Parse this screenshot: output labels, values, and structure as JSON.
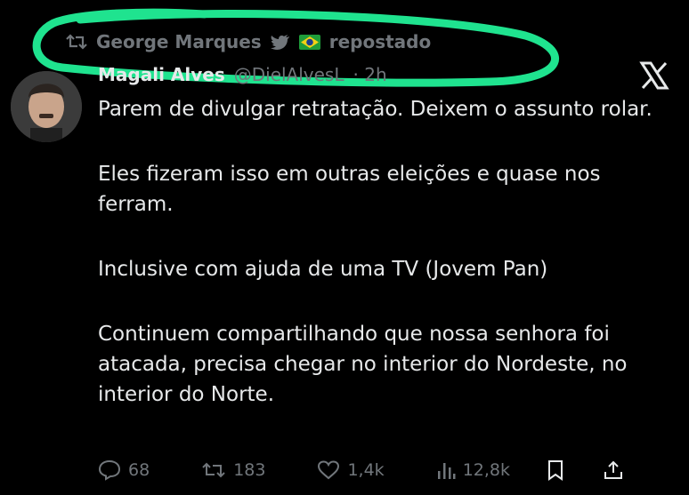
{
  "repost": {
    "icon": "repost-icon",
    "reposter_name": "George Marques",
    "badges": [
      "bird-icon",
      "brazil-flag-icon"
    ],
    "suffix": "repostado"
  },
  "author": {
    "avatar_icon": "avatar",
    "name": "Magali Alves",
    "handle": "@DielAlvesL",
    "time": "· 2h"
  },
  "brand_icon": "x-logo-icon",
  "tweet": {
    "paragraphs": [
      "Parem de divulgar retratação. Deixem o assunto rolar.",
      "Eles fizeram isso em outras eleições e quase nos ferram.",
      "Inclusive com ajuda de uma TV (Jovem Pan)",
      "Continuem compartilhando que nossa senhora foi atacada, precisa chegar no interior do Nordeste, no interior do Norte."
    ]
  },
  "actions": {
    "replies": "68",
    "reposts": "183",
    "likes": "1,4k",
    "views": "12,8k",
    "reply_icon": "reply-icon",
    "repost_icon": "repost-icon",
    "like_icon": "heart-icon",
    "views_icon": "views-icon",
    "bookmark_icon": "bookmark-icon",
    "share_icon": "share-icon"
  },
  "colors": {
    "background": "#000000",
    "text": "#e7e9ea",
    "muted": "#71767b",
    "highlight": "#1fe38f"
  }
}
